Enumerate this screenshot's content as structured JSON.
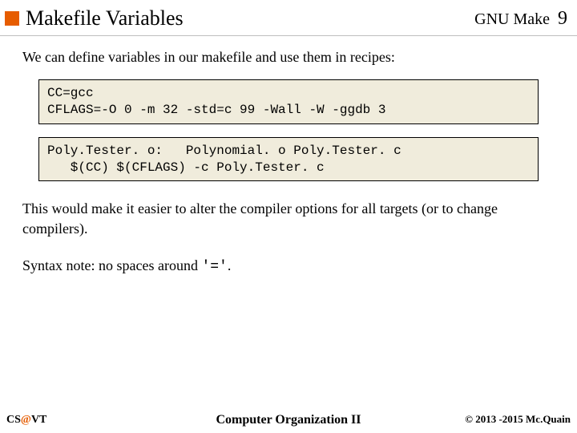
{
  "header": {
    "title": "Makefile Variables",
    "topic": "GNU Make",
    "page": "9"
  },
  "intro": "We can define variables in our makefile and use them in recipes:",
  "code1": "CC=gcc\nCFLAGS=-O 0 -m 32 -std=c 99 -Wall -W -ggdb 3",
  "code2": "Poly.Tester. o:   Polynomial. o Poly.Tester. c\n   $(CC) $(CFLAGS) -c Poly.Tester. c",
  "para1": "This would make it easier to alter the compiler options for all targets (or to change compilers).",
  "syntax_prefix": "Syntax note:  no spaces around ",
  "syntax_code": "'='",
  "syntax_suffix": ".",
  "footer": {
    "org_left": "CS",
    "org_at": "@",
    "org_right": "VT",
    "course": "Computer Organization II",
    "copyright": "© 2013 -2015 Mc.Quain"
  }
}
